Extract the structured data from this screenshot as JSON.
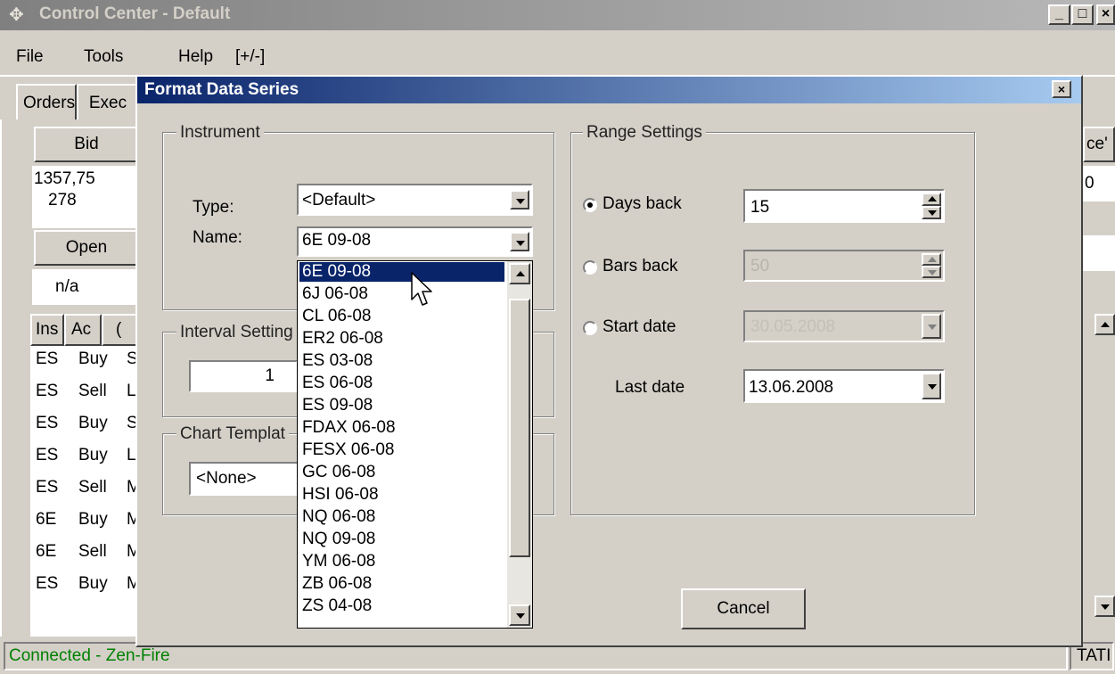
{
  "window": {
    "title": "Control Center - Default",
    "min_label": "_",
    "max_label": "□",
    "close_label": "×"
  },
  "menu": [
    "File",
    "Tools",
    "Help",
    "[+/-]"
  ],
  "tabs": [
    "Orders",
    "Exec"
  ],
  "bg_panel": {
    "bid_label": "Bid",
    "bid_value": "1357,75",
    "bid_size": "278",
    "open_label": "Open",
    "open_value": "n/a",
    "right_header": "ce'",
    "right_value": "0"
  },
  "bg_table": {
    "headers": [
      "Ins",
      "Ac",
      "("
    ],
    "rows": [
      [
        "ES",
        "Buy",
        "St"
      ],
      [
        "ES",
        "Sell",
        "Li"
      ],
      [
        "ES",
        "Buy",
        "St"
      ],
      [
        "ES",
        "Buy",
        "Li"
      ],
      [
        "ES",
        "Sell",
        "M"
      ],
      [
        "6E",
        "Buy",
        "M"
      ],
      [
        "6E",
        "Sell",
        "M"
      ],
      [
        "ES",
        "Buy",
        "M"
      ]
    ]
  },
  "status": {
    "left": "Connected - Zen-Fire",
    "right": "TATI"
  },
  "dialog": {
    "title": "Format Data Series",
    "close_label": "×",
    "instrument": {
      "legend": "Instrument",
      "type_label": "Type:",
      "type_value": "<Default>",
      "name_label": "Name:",
      "name_value": "6E 09-08"
    },
    "interval": {
      "legend": "Interval Setting",
      "value": "1"
    },
    "template": {
      "legend": "Chart Templat",
      "value": "<None>"
    },
    "range": {
      "legend": "Range Settings",
      "days_back_label": "Days back",
      "days_back_value": "15",
      "bars_back_label": "Bars back",
      "bars_back_value": "50",
      "start_date_label": "Start date",
      "start_date_value": "30.05.2008",
      "last_date_label": "Last date",
      "last_date_value": "13.06.2008",
      "selected": "Days back"
    },
    "cancel_label": "Cancel",
    "dropdown_items": [
      "6E 09-08",
      "6J 06-08",
      "CL 06-08",
      "ER2 06-08",
      "ES 03-08",
      "ES 06-08",
      "ES 09-08",
      "FDAX 06-08",
      "FESX 06-08",
      "GC 06-08",
      "HSI 06-08",
      "NQ 06-08",
      "NQ 09-08",
      "YM 06-08",
      "ZB 06-08",
      "ZS 04-08"
    ],
    "dropdown_selected": "6E 09-08"
  }
}
